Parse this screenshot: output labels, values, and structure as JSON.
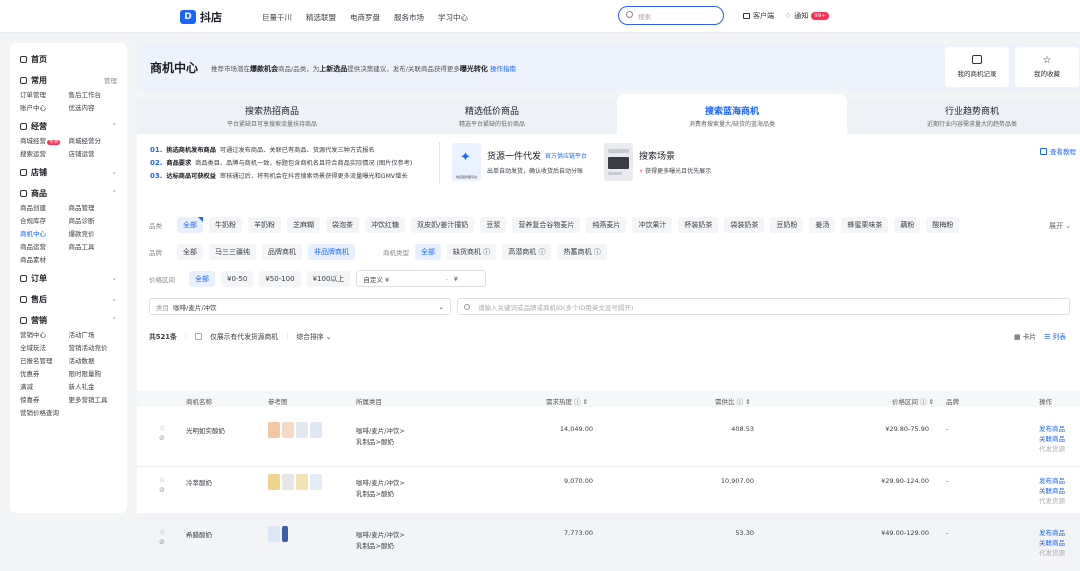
{
  "topbar": {
    "brand": "抖店",
    "nav": [
      "巨量千川",
      "精选联盟",
      "电商罗盘",
      "服务市场",
      "学习中心"
    ],
    "search_placeholder": "搜索",
    "customer_service": "客户端",
    "messages": "通知",
    "badge": "99+"
  },
  "sidebar": {
    "home": "首页",
    "groups": [
      {
        "title": "常用",
        "action": "管理",
        "items": [
          "订单管理",
          "售后工作台",
          "账户中心",
          "优选内容"
        ]
      },
      {
        "title": "经营",
        "items": [
          "商城经营",
          "商城经营分",
          "搜索运营",
          "店铺运营"
        ],
        "hot": "专项"
      },
      {
        "title": "店铺",
        "items": []
      },
      {
        "title": "商品",
        "items": [
          "商品创建",
          "商品管理",
          "合规库存",
          "商品诊断",
          "商机中心",
          "爆款竞价",
          "商品运营",
          "商品工具",
          "商品素材"
        ]
      },
      {
        "title": "订单",
        "items": []
      },
      {
        "title": "售后",
        "items": []
      },
      {
        "title": "营销",
        "items": [
          "营销中心",
          "活动广场",
          "全域玩法",
          "营销活动竞价",
          "已报名管理",
          "活动数据",
          "优惠券",
          "限时限量购",
          "满减",
          "新人礼金",
          "惊喜券",
          "更多营销工具",
          "营销价格查询"
        ]
      }
    ],
    "active_item": "商机中心"
  },
  "header": {
    "title": "商机中心",
    "desc_pre": "推荐市场潜在",
    "desc_b1": "爆款机会",
    "desc_mid": "商品/品类，为",
    "desc_b2": "上新选品",
    "desc_post": "提供决策建议，发布/关联商品获得更多",
    "desc_b3": "曝光转化",
    "guide": "操作指南",
    "btn_records": "我的商机记录",
    "btn_favs": "我的收藏"
  },
  "tabs": [
    {
      "title": "搜索热招商品",
      "sub": "平台紧缺且可享搜索流量扶持商品"
    },
    {
      "title": "精选低价商品",
      "sub": "精选平台紧缺的低价商品"
    },
    {
      "title": "搜索蓝海商机",
      "sub": "消费者搜索量大/缺货的蓝海品类"
    },
    {
      "title": "行业趋势商机",
      "sub": "近期行业内容需求量大的趋势品类"
    }
  ],
  "steps": [
    {
      "n": "01.",
      "label": "挑选商机发布商品",
      "text": "可通过发布商品、关联已有商品、货源代发三种方式报名"
    },
    {
      "n": "02.",
      "label": "商品要求",
      "text": "商品类目、品牌与商机一致，标题包含商机名且符合商品实际情况 (图片仅参考)"
    },
    {
      "n": "03.",
      "label": "达标商品可获权益",
      "text": "审核通过后，将有机会在抖音搜索场景获得更多流量曝光和GMV增长"
    }
  ],
  "cards": [
    {
      "title": "货源一件代发",
      "tag": "官方供应链平台",
      "sub": "出单自动发货，确认收货后自动分账",
      "thumb_text": "供应链管理平台"
    },
    {
      "title": "搜索场景",
      "tag": "",
      "sub": "获得更多曝光且优先展示"
    }
  ],
  "doc_link": "查看教程",
  "filters": {
    "category_label": "品类",
    "categories": [
      "全部",
      "牛奶粉",
      "羊奶粉",
      "芝麻糊",
      "袋泡茶",
      "冲饮红糖",
      "双皮奶/姜汁撞奶",
      "豆浆",
      "营养复合谷物麦片",
      "纯燕麦片",
      "冲饮果汁",
      "杯装奶茶",
      "袋装奶茶",
      "豆奶粉",
      "姜汤",
      "蜂蜜栗味茶",
      "藕粉",
      "酸梅粉"
    ],
    "more": "展开",
    "brand_label": "品牌",
    "brands": [
      "全部",
      "马三三疆纯",
      "品牌商机",
      "非品牌商机"
    ],
    "type_label": "商机类型",
    "types": [
      "全部",
      "缺货商机",
      "高潜商机",
      "热蓄商机"
    ],
    "price_label": "价格区间",
    "prices": [
      "全部",
      "¥0-50",
      "¥50-100",
      "¥100以上"
    ],
    "custom_label": "自定义 ¥",
    "custom_to": "¥",
    "cat_select_label": "类目",
    "cat_select_value": "咖啡/麦片/冲饮",
    "kw_placeholder": "请输入关键词或品牌或商机ID(多个ID用英文逗号隔开)"
  },
  "toolbar": {
    "count": "共521条",
    "only_supply": "仅展示有代发货源商机",
    "sort": "综合排序",
    "view_card": "卡片",
    "view_list": "列表"
  },
  "table": {
    "headers": [
      "商机名称",
      "参考图",
      "所属类目",
      "需求热度",
      "需供比",
      "价格区间",
      "品牌",
      "操作"
    ],
    "rows": [
      {
        "name": "光明如实酸奶",
        "cat1": "咖啡/麦片/冲饮>",
        "cat2": "乳制品>酸奶",
        "heat": "14,049.00",
        "ratio": "408.53",
        "price": "¥29.80-75.90",
        "brand": "-",
        "ops": [
          "发布商品",
          "关联商品",
          "代发货源"
        ]
      },
      {
        "name": "冷萃酸奶",
        "cat1": "咖啡/麦片/冲饮>",
        "cat2": "乳制品>酸奶",
        "heat": "9,070.00",
        "ratio": "10,907.00",
        "price": "¥29.90-124.00",
        "brand": "-",
        "ops": [
          "发布商品",
          "关联商品",
          "代发货源"
        ]
      },
      {
        "name": "希腊酸奶",
        "cat1": "咖啡/麦片/冲饮>",
        "cat2": "乳制品>酸奶",
        "heat": "7,773.00",
        "ratio": "53.30",
        "price": "¥49.00-129.00",
        "brand": "-",
        "ops": [
          "发布商品",
          "关联商品",
          "代发货源"
        ]
      }
    ]
  },
  "colors": {
    "accent": "#1966ff",
    "hot": "#ff2e54"
  }
}
